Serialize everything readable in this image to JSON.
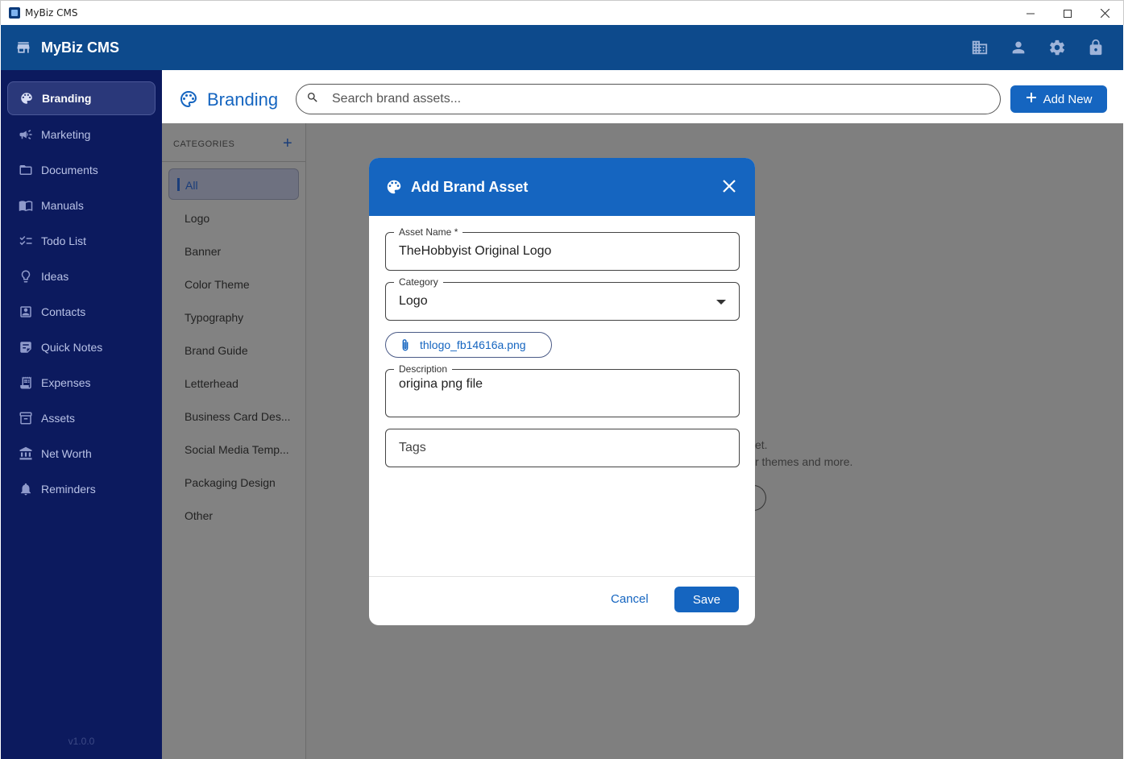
{
  "window": {
    "title": "MyBiz CMS"
  },
  "appbar": {
    "app_name": "MyBiz CMS",
    "icons": [
      "business-icon",
      "person-icon",
      "settings-icon",
      "lock-icon"
    ]
  },
  "sidebar": {
    "items": [
      {
        "label": "Branding",
        "icon": "palette-icon",
        "active": true
      },
      {
        "label": "Marketing",
        "icon": "campaign-icon"
      },
      {
        "label": "Documents",
        "icon": "folder-icon"
      },
      {
        "label": "Manuals",
        "icon": "book-icon"
      },
      {
        "label": "Todo List",
        "icon": "checklist-icon"
      },
      {
        "label": "Ideas",
        "icon": "lightbulb-icon"
      },
      {
        "label": "Contacts",
        "icon": "contacts-icon"
      },
      {
        "label": "Quick Notes",
        "icon": "note-icon"
      },
      {
        "label": "Expenses",
        "icon": "receipt-icon"
      },
      {
        "label": "Assets",
        "icon": "archive-icon"
      },
      {
        "label": "Net Worth",
        "icon": "bank-icon"
      },
      {
        "label": "Reminders",
        "icon": "bell-icon"
      }
    ],
    "version": "v1.0.0"
  },
  "page": {
    "title": "Branding",
    "search_placeholder": "Search brand assets...",
    "add_new_label": "Add New",
    "categories_heading": "CATEGORIES",
    "categories": [
      "All",
      "Logo",
      "Banner",
      "Color Theme",
      "Typography",
      "Brand Guide",
      "Letterhead",
      "Business Card Des...",
      "Social Media Temp...",
      "Packaging Design",
      "Other"
    ],
    "empty_line1": "et.",
    "empty_line2": "r themes and more."
  },
  "dialog": {
    "title": "Add Brand Asset",
    "asset_name_label": "Asset Name *",
    "asset_name_value": "TheHobbyist Original Logo",
    "category_label": "Category",
    "category_value": "Logo",
    "attachment_filename": "thlogo_fb14616a.png",
    "description_label": "Description",
    "description_value": "origina png file",
    "tags_placeholder": "Tags",
    "cancel_label": "Cancel",
    "save_label": "Save"
  },
  "colors": {
    "appbar": "#0d4a8c",
    "sidebar": "#0c1a5e",
    "primary": "#1565c0",
    "overlay": "#7f7f7f"
  }
}
